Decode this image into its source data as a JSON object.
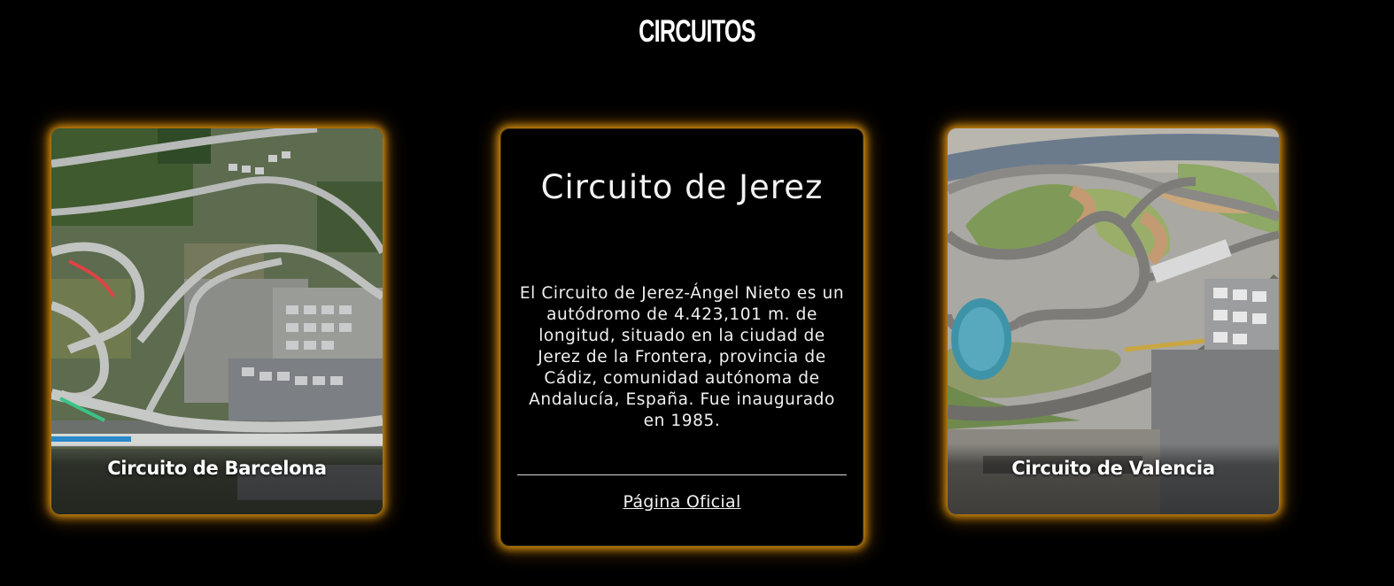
{
  "page": {
    "heading": "CIRCUITOS"
  },
  "cards": {
    "barcelona": {
      "title": "Circuito de Barcelona"
    },
    "jerez": {
      "title": "Circuito de Jerez",
      "description": "El Circuito de Jerez-Ángel Nieto es un autódromo de 4.423,101 m. de longitud, situado en la ciudad de Jerez de la Frontera, provincia de Cádiz, comunidad autónoma de Andalucía, España. Fue inaugurado en 1985.",
      "link_label": "Página Oficial"
    },
    "valencia": {
      "title": "Circuito de Valencia"
    }
  },
  "colors": {
    "background": "#000000",
    "glow": "#ffaa14",
    "text": "#ffffff"
  }
}
